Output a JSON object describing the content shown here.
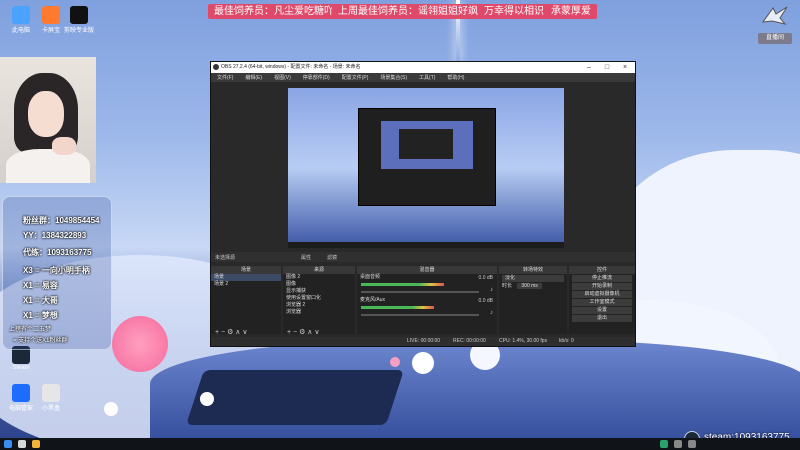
{
  "banners": [
    "最佳饲养员：凡尘爱吃糖吖",
    "上周最佳饲养员：谣翎姐姐好飒",
    "万幸得以相识",
    "承蒙厚爱"
  ],
  "colors": {
    "banner": "#e04a6a",
    "obs_bg": "#292929",
    "desktop_sky": "#9db8ea"
  },
  "desktop_icons": [
    {
      "label": "此电脑",
      "icon": "computer-icon"
    },
    {
      "label": "卡屏宝",
      "icon": "app-icon"
    },
    {
      "label": "剪映专业版",
      "icon": "capcut-icon"
    },
    {
      "label": "Steam",
      "icon": "steam-icon"
    },
    {
      "label": "电脑管家",
      "icon": "shield-icon"
    },
    {
      "label": "小黑盒",
      "icon": "box-icon"
    }
  ],
  "gift_panel": {
    "lines": [
      "粉丝群：1049854454",
      "YY：1384322893",
      "代练：1093163775",
      "X3 = 一向小明手柄",
      "X1 = 易容",
      "X1 = 大哥",
      "X1 = 梦想",
      "上榜有个二五梦",
      "= 支持个送X1粉丝群"
    ]
  },
  "obs": {
    "title": "OBS 27.2.4 (64-bit, windows) - 配置文件: 未命名 - 场景: 未命名",
    "menu": [
      "文件(F)",
      "编辑(E)",
      "视图(V)",
      "停靠部件(D)",
      "配置文件(P)",
      "场景集合(S)",
      "工具(T)",
      "帮助(H)"
    ],
    "preview_bar": {
      "no_source": "未选择源",
      "properties": "属性",
      "filters": "滤镜"
    },
    "docks": {
      "scenes": {
        "title": "场景",
        "items": [
          "场景",
          "场景 2"
        ]
      },
      "sources": {
        "title": "来源",
        "items": [
          "图像 2",
          "图像",
          "显示捕获",
          "使用设置窗口化",
          "浏览器 2",
          "浏览器"
        ]
      },
      "mixer": {
        "title": "混音器",
        "channels": [
          {
            "name": "桌面音频",
            "db": "0.0 dB",
            "level": 0.7
          },
          {
            "name": "麦克风/Aux",
            "db": "0.0 dB",
            "level": 0.62
          }
        ]
      },
      "transitions": {
        "title": "转场特效",
        "type": "淡化",
        "duration_label": "时长",
        "duration": "300 ms"
      },
      "controls": {
        "title": "控件",
        "buttons": [
          "停止推流",
          "开始录制",
          "启动虚拟摄像机",
          "工作室模式",
          "设置",
          "退出"
        ]
      }
    },
    "status": {
      "live": "LIVE: 00:00:00",
      "rec": "REC: 00:00:00",
      "cpu": "CPU: 1.4%, 30.00 fps",
      "kbps": "kb/s: 0"
    }
  },
  "corner_badge": "直播间",
  "steam_overlay": "steam:1093163775"
}
